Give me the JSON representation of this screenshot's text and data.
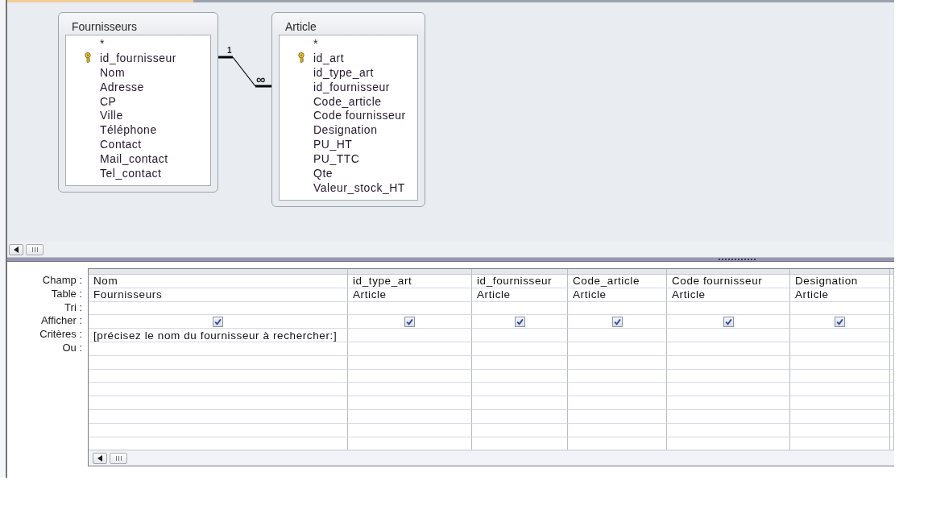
{
  "design_view": {
    "tables": [
      {
        "title": "Fournisseurs",
        "fields": [
          {
            "name": "*",
            "primary_key": false
          },
          {
            "name": "id_fournisseur",
            "primary_key": true
          },
          {
            "name": "Nom",
            "primary_key": false
          },
          {
            "name": "Adresse",
            "primary_key": false
          },
          {
            "name": "CP",
            "primary_key": false
          },
          {
            "name": "Ville",
            "primary_key": false
          },
          {
            "name": "Téléphone",
            "primary_key": false
          },
          {
            "name": "Contact",
            "primary_key": false
          },
          {
            "name": "Mail_contact",
            "primary_key": false
          },
          {
            "name": "Tel_contact",
            "primary_key": false
          }
        ]
      },
      {
        "title": "Article",
        "fields": [
          {
            "name": "*",
            "primary_key": false
          },
          {
            "name": "id_art",
            "primary_key": true
          },
          {
            "name": "id_type_art",
            "primary_key": false
          },
          {
            "name": "id_fournisseur",
            "primary_key": false
          },
          {
            "name": "Code_article",
            "primary_key": false
          },
          {
            "name": "Code fournisseur",
            "primary_key": false
          },
          {
            "name": "Designation",
            "primary_key": false
          },
          {
            "name": "PU_HT",
            "primary_key": false
          },
          {
            "name": "PU_TTC",
            "primary_key": false
          },
          {
            "name": "Qte",
            "primary_key": false
          },
          {
            "name": "Valeur_stock_HT",
            "primary_key": false
          }
        ]
      }
    ],
    "relationship": {
      "one_label": "1",
      "many_label": "∞"
    }
  },
  "query_grid": {
    "row_labels": [
      "Champ :",
      "Table :",
      "Tri :",
      "Afficher :",
      "Critères :",
      "Ou :"
    ],
    "columns": [
      {
        "field": "Nom",
        "table": "Fournisseurs",
        "show": true,
        "criteria": "[précisez le nom du fournisseur à rechercher:]"
      },
      {
        "field": "id_type_art",
        "table": "Article",
        "show": true
      },
      {
        "field": "id_fournisseur",
        "table": "Article",
        "show": true
      },
      {
        "field": "Code_article",
        "table": "Article",
        "show": true
      },
      {
        "field": "Code fournisseur",
        "table": "Article",
        "show": true
      },
      {
        "field": "Designation",
        "table": "Article",
        "show": true
      }
    ]
  }
}
